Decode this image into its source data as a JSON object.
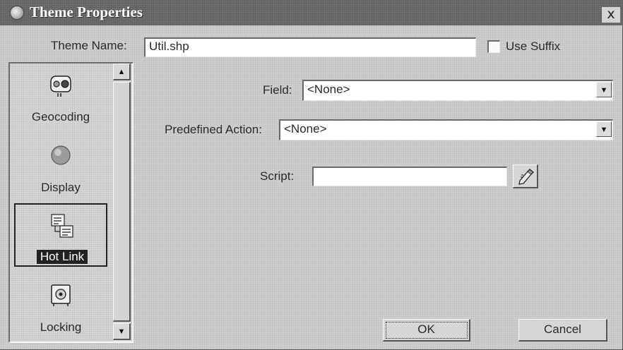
{
  "window": {
    "title": "Theme Properties",
    "close_glyph": "x"
  },
  "theme_name": {
    "label": "Theme Name:",
    "value": "Util.shp"
  },
  "use_suffix": {
    "label": "Use Suffix",
    "checked": false
  },
  "sidebar": {
    "items": [
      {
        "label": "Geocoding",
        "icon": "geocoding-icon",
        "selected": false
      },
      {
        "label": "Display",
        "icon": "display-icon",
        "selected": false
      },
      {
        "label": "Hot Link",
        "icon": "hot-link-icon",
        "selected": true
      },
      {
        "label": "Locking",
        "icon": "locking-icon",
        "selected": false
      }
    ]
  },
  "form": {
    "field_label": "Field:",
    "field_value": "<None>",
    "action_label": "Predefined Action:",
    "action_value": "<None>",
    "script_label": "Script:",
    "script_value": ""
  },
  "buttons": {
    "ok": "OK",
    "cancel": "Cancel"
  }
}
